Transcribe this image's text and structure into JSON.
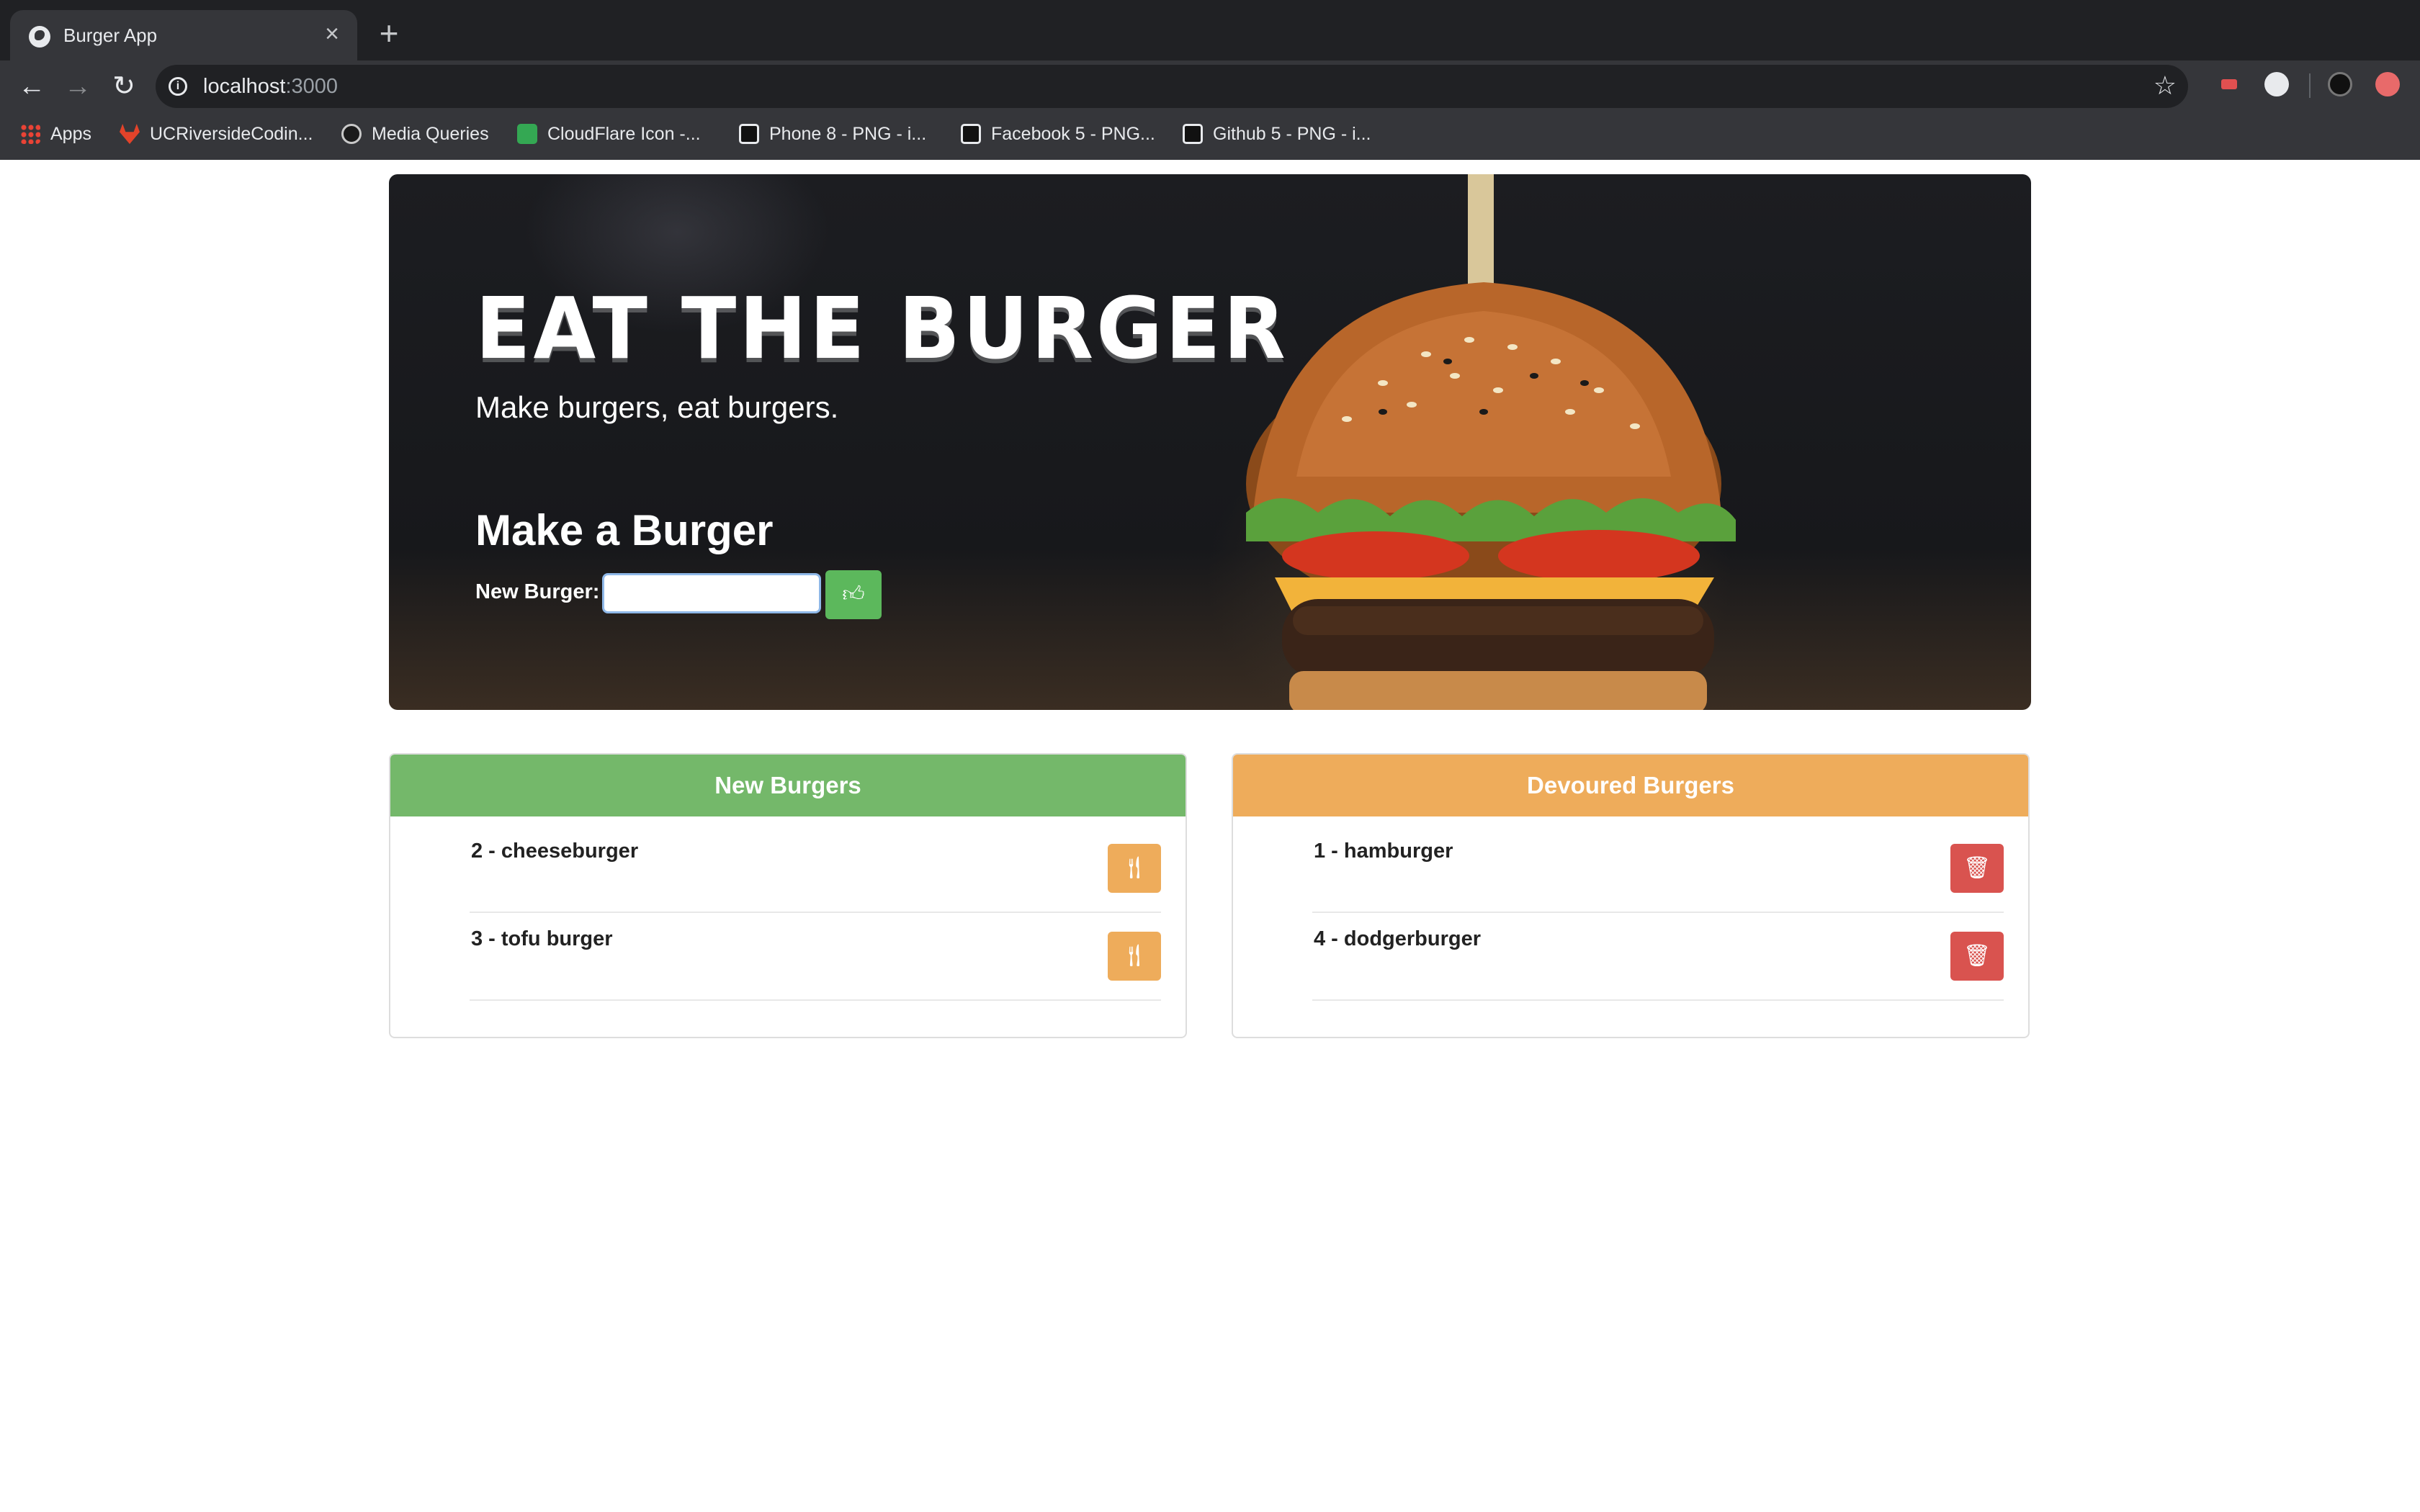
{
  "browser": {
    "tab_title": "Burger App",
    "url_host": "localhost",
    "url_port": ":3000",
    "bookmarks": [
      {
        "label": "Apps",
        "icon": "apps-grid-icon"
      },
      {
        "label": "UCRiversideCodin...",
        "icon": "gitlab-icon"
      },
      {
        "label": "Media Queries",
        "icon": "github-icon"
      },
      {
        "label": "CloudFlare Icon -...",
        "icon": "cloudflare-icon"
      },
      {
        "label": "Phone 8 - PNG - i...",
        "icon": "png-site-icon"
      },
      {
        "label": "Facebook 5 - PNG...",
        "icon": "png-site-icon"
      },
      {
        "label": "Github 5 - PNG - i...",
        "icon": "png-site-icon"
      }
    ]
  },
  "hero": {
    "title": "EAT THE BURGER",
    "subtitle": "Make burgers, eat burgers.",
    "form_heading": "Make a Burger",
    "input_label": "New Burger:",
    "input_value": "",
    "submit_icon": "thumbs-up-icon"
  },
  "new_burgers": {
    "heading": "New Burgers",
    "accent": "#74b86a",
    "items": [
      {
        "label": "2 - cheeseburger",
        "action_icon": "cutlery-icon"
      },
      {
        "label": "3 - tofu burger",
        "action_icon": "cutlery-icon"
      }
    ]
  },
  "devoured_burgers": {
    "heading": "Devoured Burgers",
    "accent": "#eeac5b",
    "items": [
      {
        "label": "1 - hamburger",
        "action_icon": "trash-icon"
      },
      {
        "label": "4 - dodgerburger",
        "action_icon": "trash-icon"
      }
    ]
  }
}
